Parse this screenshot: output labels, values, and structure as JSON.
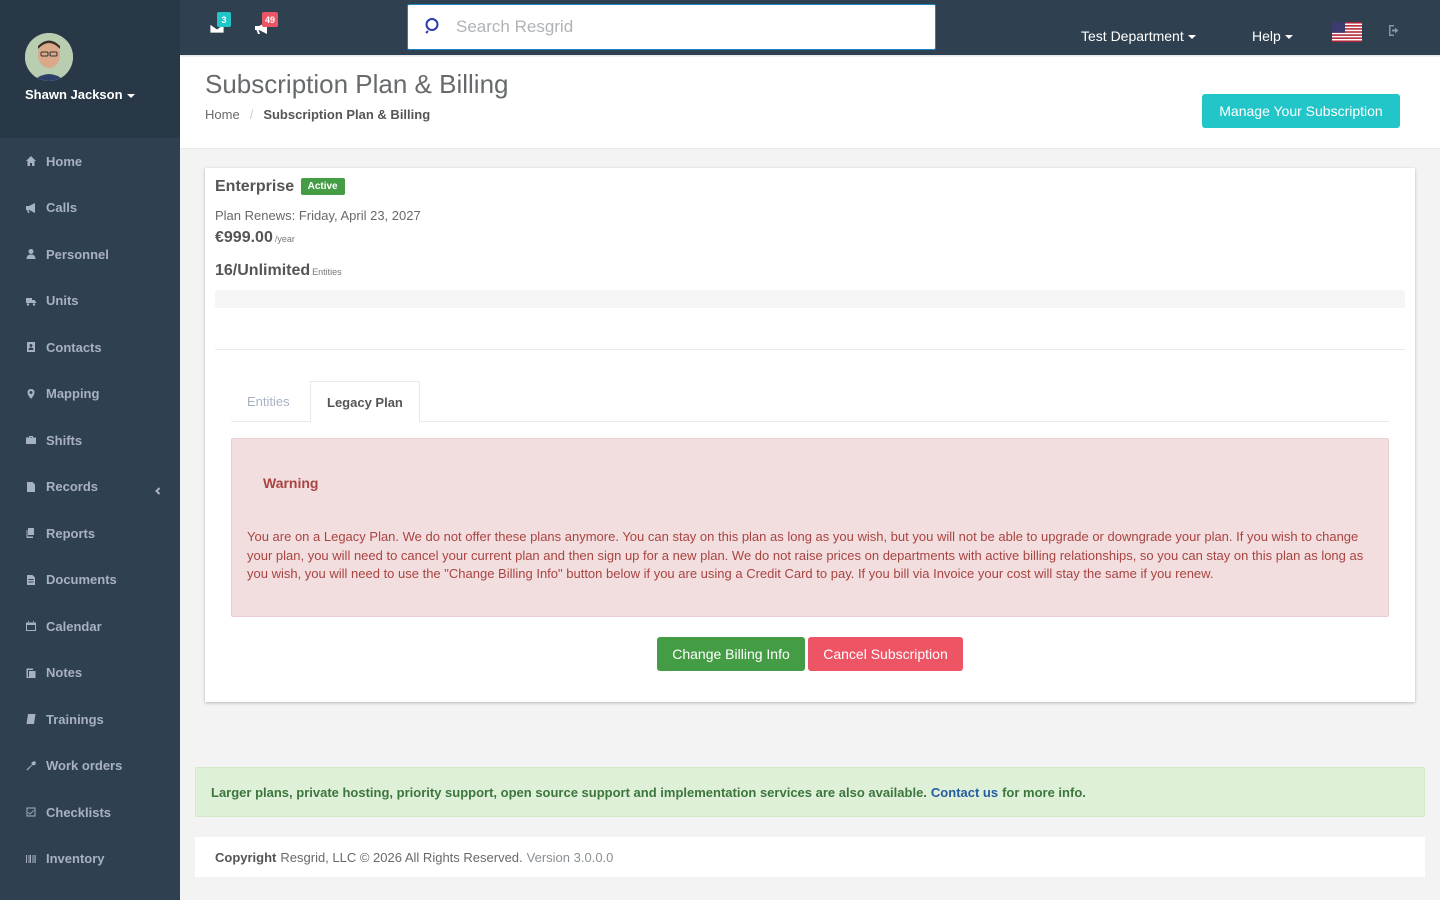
{
  "user": {
    "name": "Shawn Jackson"
  },
  "sidebar": {
    "items": [
      {
        "label": "Home",
        "icon": "home-icon"
      },
      {
        "label": "Calls",
        "icon": "bullhorn-icon"
      },
      {
        "label": "Personnel",
        "icon": "user-icon"
      },
      {
        "label": "Units",
        "icon": "truck-icon"
      },
      {
        "label": "Contacts",
        "icon": "address-book-icon"
      },
      {
        "label": "Mapping",
        "icon": "map-marker-icon"
      },
      {
        "label": "Shifts",
        "icon": "briefcase-icon"
      },
      {
        "label": "Records",
        "icon": "file-icon"
      },
      {
        "label": "Reports",
        "icon": "report-icon"
      },
      {
        "label": "Documents",
        "icon": "document-icon"
      },
      {
        "label": "Calendar",
        "icon": "calendar-icon"
      },
      {
        "label": "Notes",
        "icon": "notes-icon"
      },
      {
        "label": "Trainings",
        "icon": "book-icon"
      },
      {
        "label": "Work orders",
        "icon": "wrench-icon"
      },
      {
        "label": "Checklists",
        "icon": "checklist-icon"
      },
      {
        "label": "Inventory",
        "icon": "barcode-icon"
      }
    ]
  },
  "topbar": {
    "messages_count": "3",
    "calls_count": "49",
    "search_placeholder": "Search Resgrid",
    "department": "Test Department",
    "help": "Help",
    "colors": {
      "messages_badge": "#23c6c8",
      "calls_badge": "#ed5565"
    }
  },
  "header": {
    "title": "Subscription Plan & Billing",
    "breadcrumb_home": "Home",
    "breadcrumb_current": "Subscription Plan & Billing",
    "manage_button": "Manage Your Subscription"
  },
  "plan": {
    "name": "Enterprise",
    "status": "Active",
    "renews": "Plan Renews: Friday, April 23, 2027",
    "price": "€999.00",
    "price_period": "/year",
    "entities_value": "16/Unlimited",
    "entities_label": "Entities",
    "usage_fraction": 0
  },
  "tabs": [
    {
      "label": "Entities",
      "active": false
    },
    {
      "label": "Legacy Plan",
      "active": true
    }
  ],
  "alert": {
    "title": "Warning",
    "text": "You are on a Legacy Plan. We do not offer these plans anymore. You can stay on this plan as long as you wish, but you will not be able to upgrade or downgrade your plan. If you wish to change your plan, you will need to cancel your current plan and then sign up for a new plan. We do not raise prices on departments with active billing relationships, so you can stay on this plan as long as you wish, you will need to use the \"Change Billing Info\" button below if you are using a Credit Card to pay. If you bill via Invoice your cost will stay the same if you renew."
  },
  "actions": {
    "change_billing": "Change Billing Info",
    "cancel_subscription": "Cancel Subscription"
  },
  "info": {
    "text": "Larger plans, private hosting, priority support, open source support and implementation services are also available.",
    "link": "Contact us",
    "suffix": "for more info."
  },
  "footer": {
    "copyright_label": "Copyright",
    "copyright_text": "Resgrid, LLC © 2026 All Rights Reserved.",
    "version": "Version 3.0.0.0"
  }
}
